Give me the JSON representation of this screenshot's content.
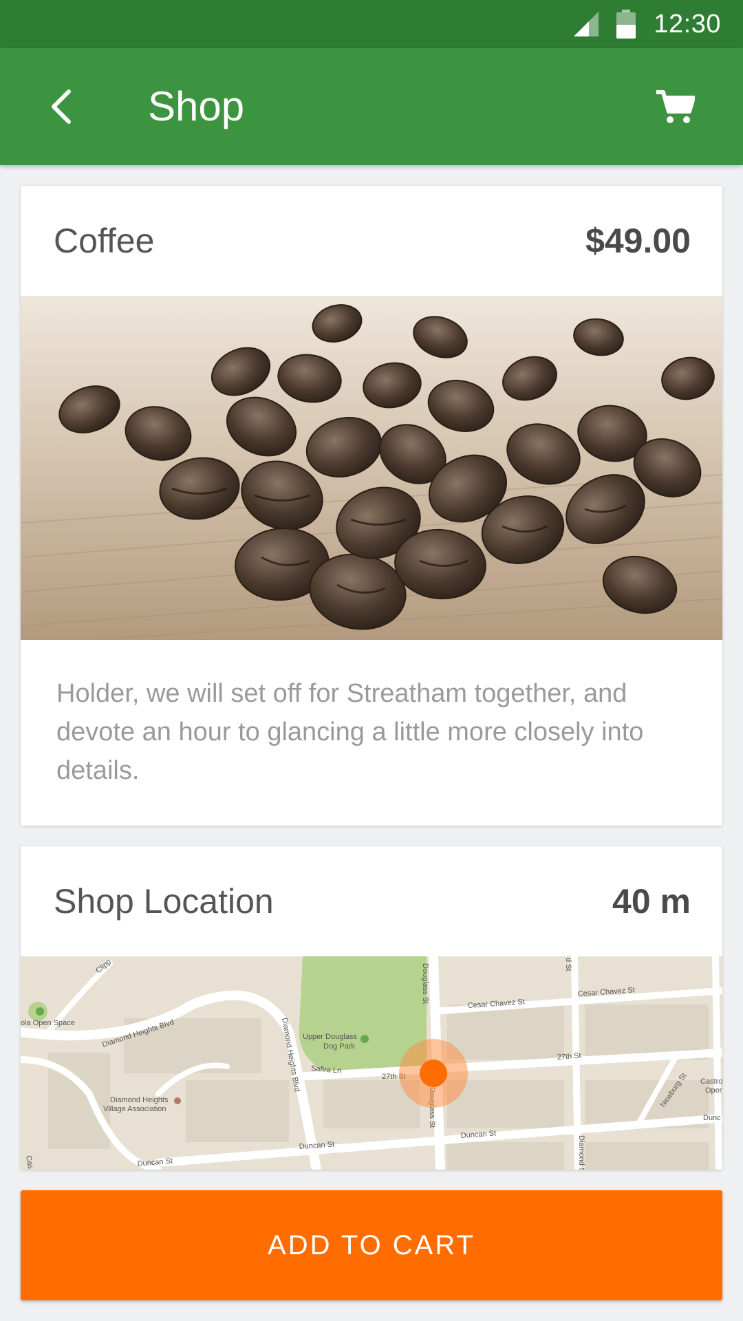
{
  "status_bar": {
    "time": "12:30"
  },
  "app_bar": {
    "title": "Shop",
    "back_icon": "arrow-back-icon",
    "cart_icon": "shopping-cart-icon"
  },
  "product": {
    "name": "Coffee",
    "price": "$49.00",
    "image": "coffee-beans-photo",
    "description": "Holder, we will set off for Streatham together, and devote an hour to glancing a little more closely into details."
  },
  "location": {
    "title": "Shop Location",
    "distance": "40 m",
    "map_labels": {
      "douglass_st_top": "Douglass St",
      "cesar_chavez_st_1": "Cesar Chavez St",
      "cesar_chavez_st_2": "Cesar Chavez St",
      "diamond_heights_blvd_1": "Diamond Heights Blvd",
      "diamond_heights_blvd_2": "Diamond Heights Blvd",
      "upper_douglass_dog_park_1": "Upper Douglass",
      "upper_douglass_dog_park_2": "Dog Park",
      "safira_ln": "Safira Ln",
      "twenty_seventh_st_1": "27th St",
      "twenty_seventh_st_2": "27th St",
      "douglass_st_bottom": "Douglass St",
      "diamond_heights_village_1": "Diamond Heights",
      "diamond_heights_village_2": "Village Association",
      "duncan_st_1": "Duncan St",
      "duncan_st_2": "Duncan St",
      "duncan_st_3": "Duncan St",
      "newburg_st": "Newburg St",
      "diamond_st": "Diamond St",
      "noe_open_space": "ola Open Space",
      "castro_open": "Castro",
      "castro_open_2": "Open",
      "dunc": "Dunc",
      "clipper": "Clipp",
      "cas": "Cas",
      "top_st": "d St"
    }
  },
  "actions": {
    "add_to_cart": "ADD TO CART"
  },
  "colors": {
    "status_bar": "#2e7d32",
    "app_bar": "#3d9440",
    "accent": "#ff6d00",
    "background": "#eef0f2"
  }
}
